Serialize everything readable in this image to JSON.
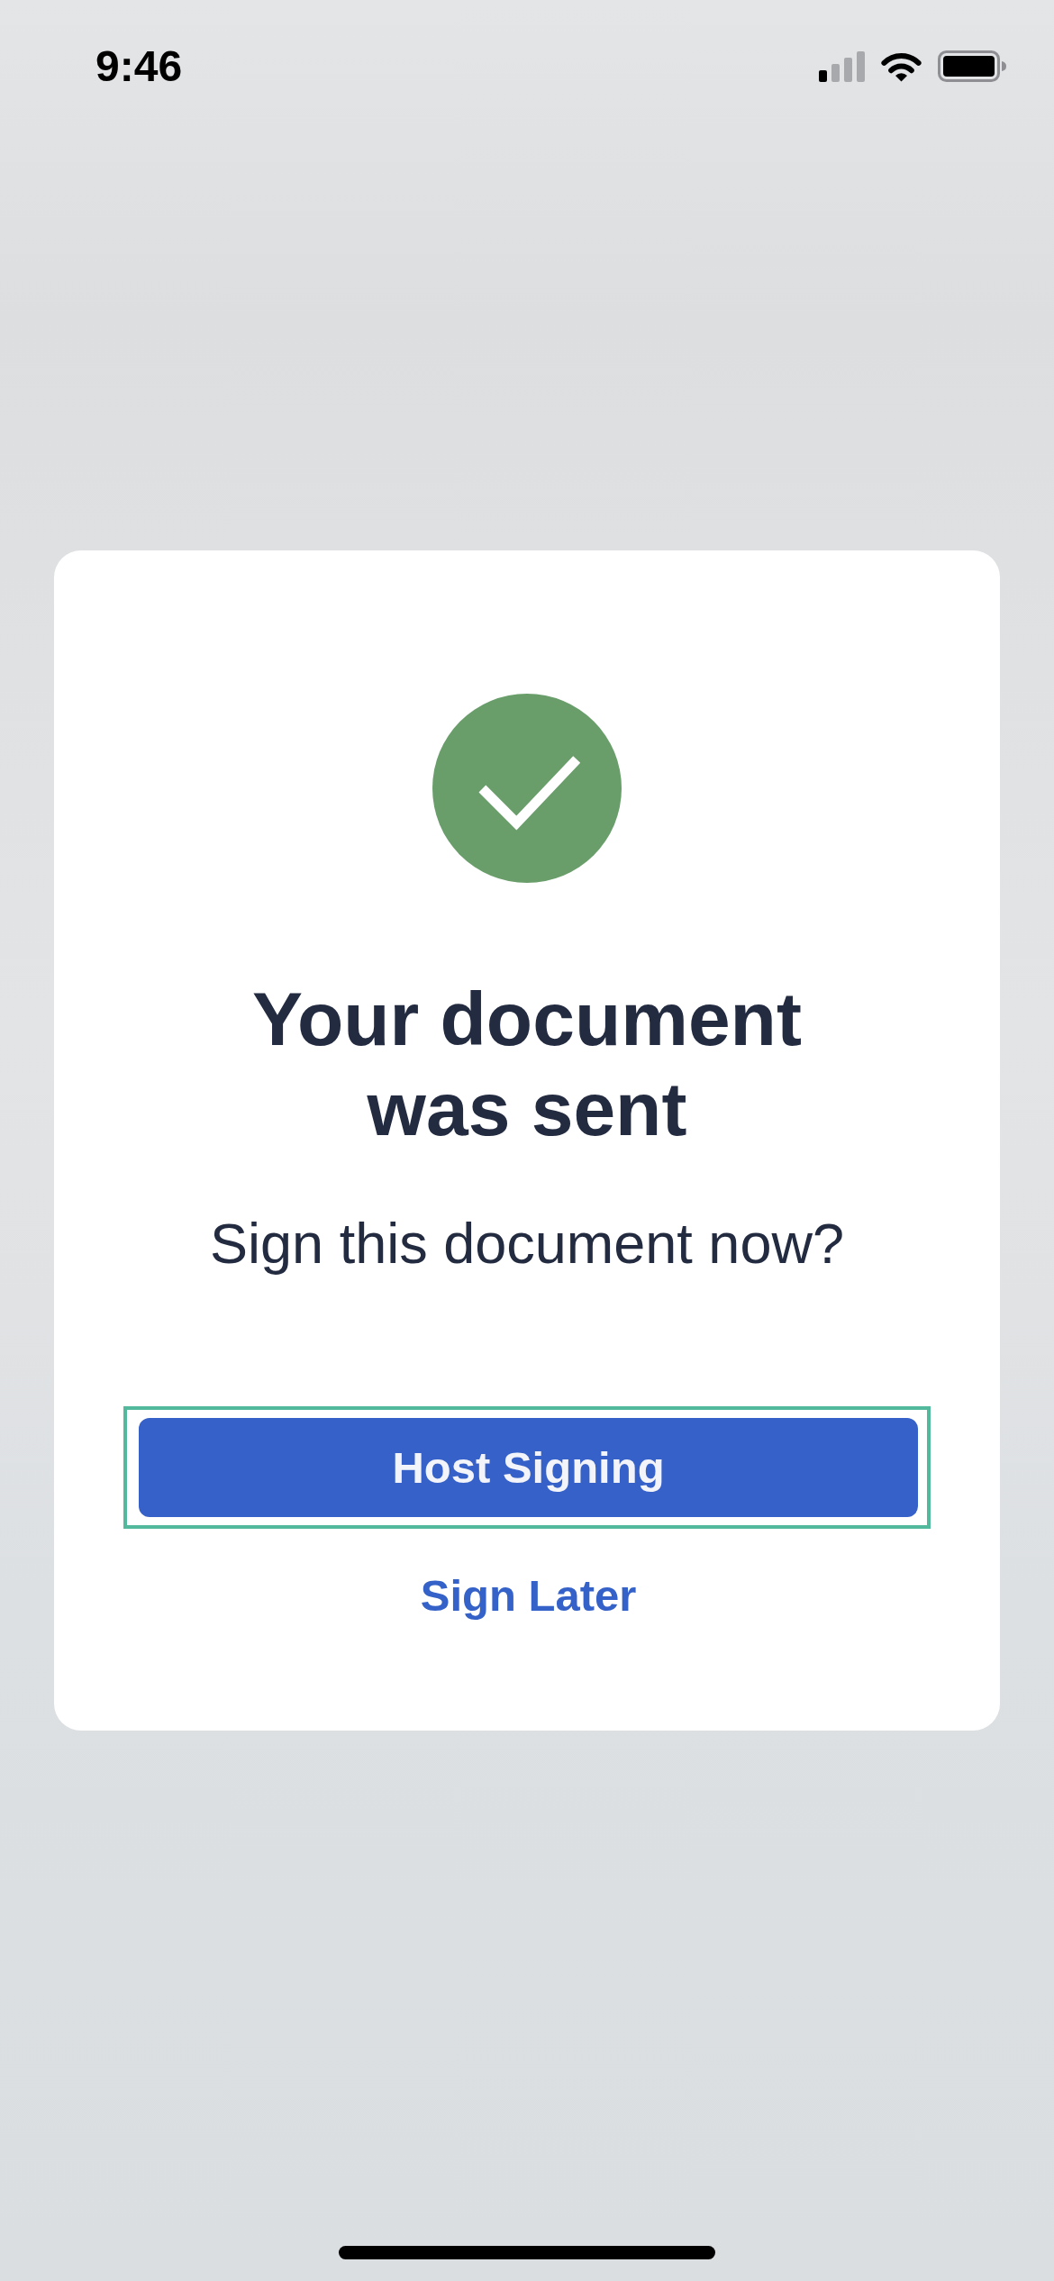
{
  "status_bar": {
    "time": "9:46"
  },
  "dialog": {
    "title": "Your document was sent",
    "message": "Sign this document now?",
    "buttons": [
      {
        "label": "Host Signing",
        "kind": "primary",
        "focused": true
      },
      {
        "label": "Sign Later",
        "kind": "link",
        "focused": false
      }
    ]
  }
}
